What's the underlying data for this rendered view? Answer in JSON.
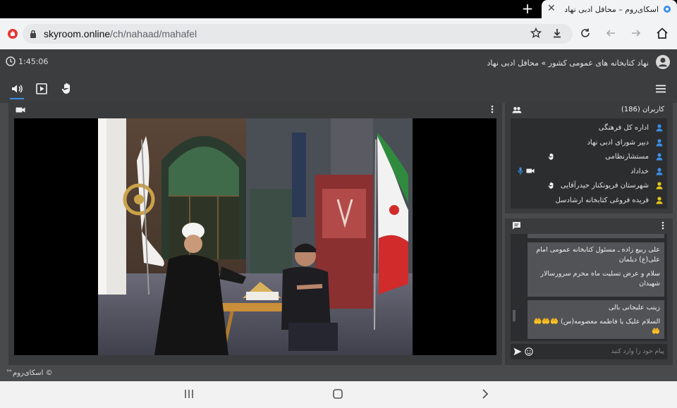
{
  "browser": {
    "tab_title": "اسکای‌روم – محافل ادبی نهاد",
    "url_host": "skyroom.online",
    "url_path": "/ch/nahaad/mahafel"
  },
  "header": {
    "timer": "1:45:06",
    "breadcrumb_org": "نهاد کتابخانه های عمومی کشور",
    "breadcrumb_sep": "»",
    "breadcrumb_room": "محافل ادبی نهاد"
  },
  "users": {
    "title": "کاربران (186)",
    "items": [
      {
        "name": "اداره کل فرهنگی",
        "role_color": "#3b8fe8",
        "hand": false,
        "cam": false,
        "mic": false
      },
      {
        "name": "دبیر شورای ادبی نهاد",
        "role_color": "#3b8fe8",
        "hand": false,
        "cam": false,
        "mic": false
      },
      {
        "name": "مستشارنظامی",
        "role_color": "#3b8fe8",
        "hand": true,
        "cam": false,
        "mic": false
      },
      {
        "name": "خداداد",
        "role_color": "#3b8fe8",
        "hand": false,
        "cam": true,
        "mic": true
      },
      {
        "name": "شهرستان فریونکنار حیدرآقایی",
        "role_color": "#e6c619",
        "hand": true,
        "cam": false,
        "mic": false
      },
      {
        "name": "فریده فروغی کتابخانه ارشادسل",
        "role_color": "#e6c619",
        "hand": false,
        "cam": false,
        "mic": false
      }
    ]
  },
  "chat": {
    "messages": [
      {
        "sender": "علی ربیع زاده ـ مسئول کتابخانه عمومی امام علی(ع) دیلمان",
        "text": "سلام و عرض تسلیت ماه محرم سرورسالار شهیدان"
      },
      {
        "sender": "زینب علیجانی بالی",
        "text": "السلام علیک یا فاطمه معصومه(س) 🤲🤲🤲🤲"
      }
    ],
    "input_placeholder": "پیام خود را وارد کنید"
  },
  "footer": {
    "copyright": "© اسکای‌روم™"
  },
  "colors": {
    "accent": "#3b8fe8",
    "guest": "#e6c619",
    "panel": "#3a3b3d"
  }
}
